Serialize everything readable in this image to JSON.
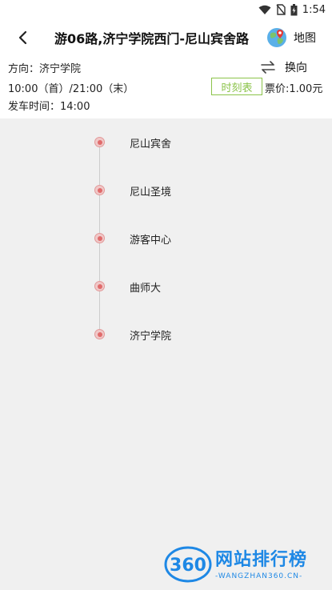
{
  "status_bar": {
    "time": "1:54"
  },
  "header": {
    "title": "游06路,济宁学院西门-尼山宾舍路",
    "map_label": "地图"
  },
  "info": {
    "direction": "方向：济宁学院",
    "hours": "10:00（首）/21:00（末）",
    "departure": "发车时间：14:00",
    "swap_label": "换向",
    "timetable_label": "时刻表",
    "fare": "票价:1.00元"
  },
  "stops": [
    "尼山宾舍",
    "尼山圣境",
    "游客中心",
    "曲师大",
    "济宁学院"
  ],
  "watermark": {
    "badge": "360",
    "title": "网站排行榜",
    "subtitle": "-WANGZHAN360.CN-"
  },
  "colors": {
    "accent_green": "#8bc34a",
    "stop_red": "#e06b6b",
    "watermark_blue": "#1e88e5"
  },
  "icons": {
    "status": [
      "wifi-icon",
      "no-sim-icon",
      "battery-icon"
    ],
    "back": "chevron-left-icon",
    "map": "globe-map-icon",
    "swap": "swap-arrows-icon"
  }
}
